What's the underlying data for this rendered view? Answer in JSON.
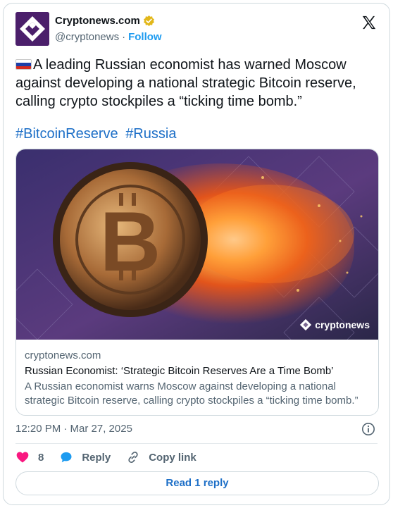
{
  "author": {
    "name": "Cryptonews.com",
    "handle": "@cryptonews",
    "follow_label": "Follow",
    "separator": "·"
  },
  "tweet": {
    "flag_icon": "russia-flag-icon",
    "text": "A leading Russian economist has warned Moscow against developing a national strategic Bitcoin reserve, calling crypto stockpiles a “ticking time bomb.”",
    "hashtags": [
      "#BitcoinReserve",
      "#Russia"
    ]
  },
  "link_card": {
    "image_watermark": "cryptonews",
    "domain": "cryptonews.com",
    "title": "Russian Economist: ‘Strategic Bitcoin Reserves Are a Time Bomb’",
    "description": "A Russian economist warns Moscow against developing a national strategic Bitcoin reserve, calling crypto stockpiles a “ticking time bomb.”"
  },
  "timestamp": "12:20 PM · Mar 27, 2025",
  "actions": {
    "like_count": "8",
    "reply_label": "Reply",
    "copy_link_label": "Copy link"
  },
  "read_replies_label": "Read 1 reply",
  "colors": {
    "accent": "#1d9bf0",
    "like": "#f91880",
    "verified_gold": "#e2b719"
  }
}
